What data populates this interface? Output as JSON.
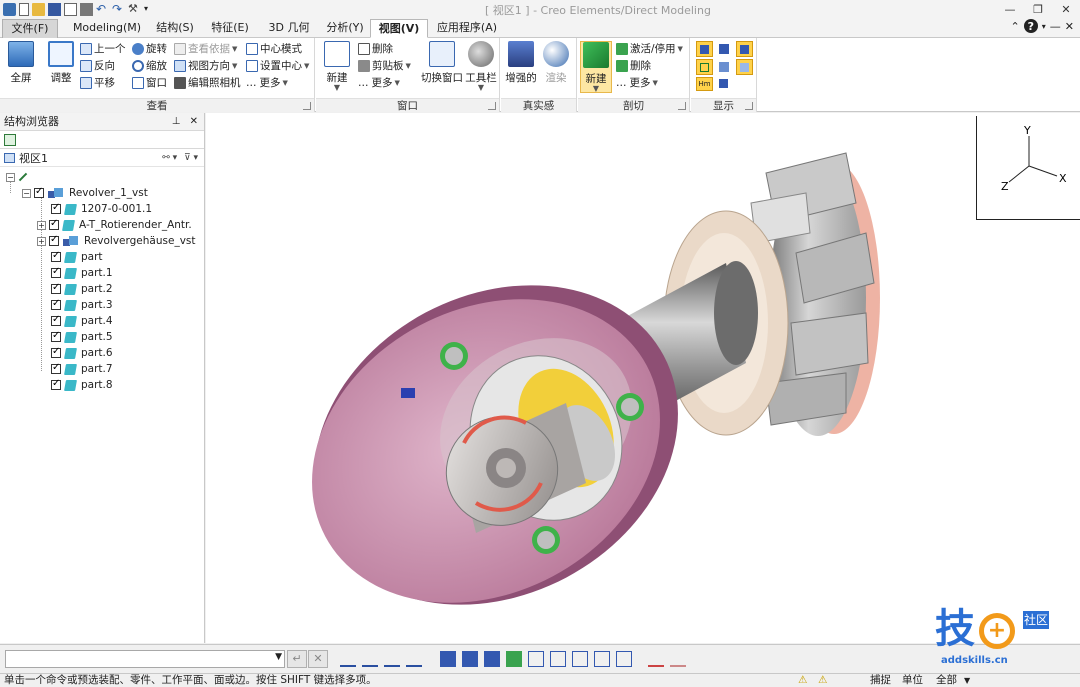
{
  "window": {
    "title": "[ 视区1 ] - Creo Elements/Direct Modeling",
    "controls": [
      "—",
      "❐",
      "✕"
    ]
  },
  "tabs": [
    {
      "label": "文件(F)"
    },
    {
      "label": "Modeling(M)"
    },
    {
      "label": "结构(S)"
    },
    {
      "label": "特征(E)"
    },
    {
      "label": "3D 几何"
    },
    {
      "label": "分析(Y)"
    },
    {
      "label": "视图(V)"
    },
    {
      "label": "应用程序(A)"
    }
  ],
  "ribbon": {
    "groups": {
      "view": "查看",
      "window": "窗口",
      "realism": "真实感",
      "section": "剖切",
      "display": "显示"
    },
    "view": {
      "fullscreen": "全屏",
      "adjust": "调整",
      "prev": "上一个",
      "reverse": "反向",
      "pan": "平移",
      "rotate": "旋转",
      "zoom": "缩放",
      "window": "窗口",
      "view_by": "查看依据",
      "view_direction": "视图方向",
      "edit_camera": "编辑照相机",
      "center_mode": "中心模式",
      "set_center": "设置中心",
      "more": "更多"
    },
    "window_group": {
      "new": "新建",
      "delete": "删除",
      "clipboard": "剪贴板",
      "more": "更多",
      "switch_window": "切换窗口",
      "toolbar": "工具栏"
    },
    "realism": {
      "enhanced": "增强的",
      "render": "渲染"
    },
    "section": {
      "new": "新建",
      "activate": "激活/停用",
      "delete": "删除",
      "more": "更多"
    }
  },
  "browser": {
    "title": "结构浏览器",
    "view_name": "视区1",
    "items": [
      {
        "label": "Revolver_1_vst"
      },
      {
        "label": "1207-0-001.1"
      },
      {
        "label": "A-T_Rotierender_Antr."
      },
      {
        "label": "Revolvergehäuse_vst"
      },
      {
        "label": "part"
      },
      {
        "label": "part.1"
      },
      {
        "label": "part.2"
      },
      {
        "label": "part.3"
      },
      {
        "label": "part.4"
      },
      {
        "label": "part.5"
      },
      {
        "label": "part.6"
      },
      {
        "label": "part.7"
      },
      {
        "label": "part.8"
      }
    ]
  },
  "triad": {
    "x": "X",
    "y": "Y",
    "z": "Z"
  },
  "status": {
    "message": "单击一个命令或预选装配、零件、工作平面、面或边。按住 SHIFT 键选择多项。",
    "catch": "捕捉",
    "unit": "单位",
    "all": "全部"
  },
  "watermark": {
    "main": "技",
    "side": "社区",
    "url": "addskills.cn"
  },
  "colors": {
    "accent": "#2b579a",
    "flange": "#c78aa9",
    "shaft": "#8a8a8a",
    "turret": "#b8b8b8",
    "highlight": "#fde7a3",
    "part_icon": "#3ab8c8"
  }
}
